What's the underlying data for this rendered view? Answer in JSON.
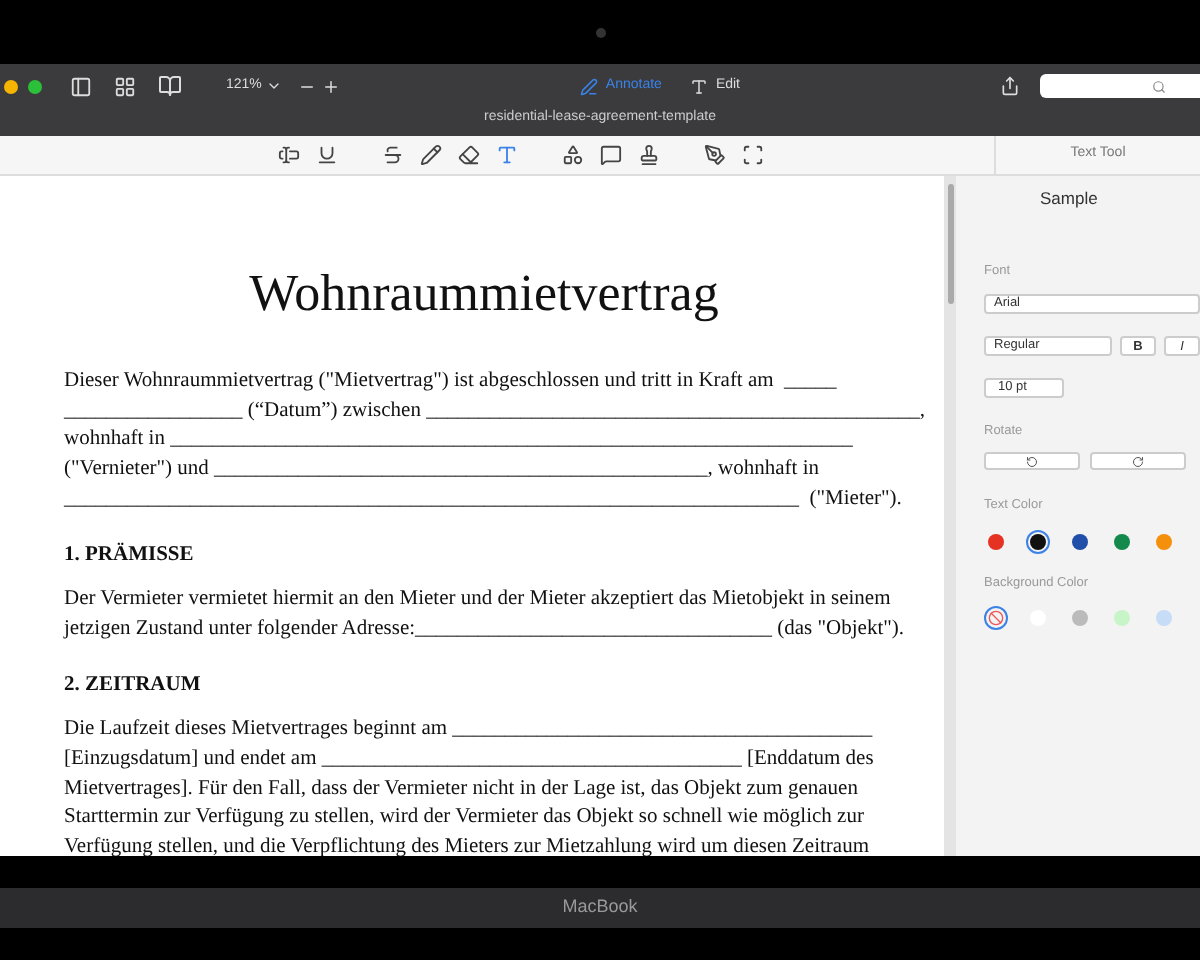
{
  "toolbar": {
    "zoom": "121%",
    "modes": [
      {
        "label": "Annotate",
        "selected": true
      },
      {
        "label": "Edit",
        "selected": false
      }
    ],
    "title": "residential-lease-agreement-template"
  },
  "tools": [
    {
      "kind": "text-box",
      "selected": false
    },
    {
      "kind": "underline",
      "selected": false
    },
    {
      "kind": "strike",
      "selected": false
    },
    {
      "kind": "pencil",
      "selected": false
    },
    {
      "kind": "eraser",
      "selected": false
    },
    {
      "kind": "text",
      "selected": true
    },
    {
      "kind": "shapes",
      "selected": false
    },
    {
      "kind": "comment",
      "selected": false
    },
    {
      "kind": "stamp",
      "selected": false
    },
    {
      "kind": "pen",
      "selected": false
    },
    {
      "kind": "select",
      "selected": false
    }
  ],
  "document": {
    "title": "Wohnraummietvertrag",
    "blocks": [
      {
        "kind": "para",
        "lines": [
          "Dieser Wohnraummietvertrag (\"Mietvertrag\") ist abgeschlossen und tritt in Kraft am  _____",
          "_________________ (“Datum”) zwischen _______________________________________________,",
          "wohnhaft in _________________________________________________________________",
          "(\"Vernieter\") und _______________________________________________, wohnhaft in",
          "______________________________________________________________________  (\"Mieter\")."
        ]
      },
      {
        "kind": "heading",
        "lines": [
          "1. PRÄMISSE"
        ]
      },
      {
        "kind": "para",
        "lines": [
          "Der Vermieter vermietet hiermit an den Mieter und der Mieter akzeptiert das Mietobjekt in seinem",
          "jetzigen Zustand unter folgender Adresse:__________________________________ (das \"Objekt\")."
        ]
      },
      {
        "kind": "heading",
        "lines": [
          "2. ZEITRAUM"
        ]
      },
      {
        "kind": "para",
        "lines": [
          "Die Laufzeit dieses Mietvertrages beginnt am ________________________________________",
          "[Einzugsdatum] und endet am ________________________________________ [Enddatum des",
          "Mietvertrages]. Für den Fall, dass der Vermieter nicht in der Lage ist, das Objekt zum genauen",
          "Starttermin zur Verfügung zu stellen, wird der Vermieter das Objekt so schnell wie möglich zur",
          "Verfügung stellen, und die Verpflichtung des Mieters zur Mietzahlung wird um diesen Zeitraum"
        ]
      }
    ]
  },
  "panel": {
    "title": "Text Tool",
    "sample": "Sample",
    "font_label": "Font",
    "font": "Arial",
    "style": "Regular",
    "bold": "B",
    "italic": "I",
    "size": "10 pt",
    "rotate_label": "Rotate",
    "text_color_label": "Text Color",
    "text_colors": [
      {
        "color": "#e53222",
        "selected": false
      },
      {
        "color": "#111111",
        "selected": true
      },
      {
        "color": "#1f4fa8",
        "selected": false
      },
      {
        "color": "#138a4b",
        "selected": false
      },
      {
        "color": "#f4900c",
        "selected": false
      }
    ],
    "background_color_label": "Background Color",
    "background_colors": [
      {
        "kind": "none",
        "selected": true
      },
      {
        "kind": "swatch",
        "color": "#ffffff",
        "selected": false
      },
      {
        "kind": "swatch",
        "color": "#bbbbbb",
        "selected": false
      },
      {
        "kind": "swatch",
        "color": "#c8f5c8",
        "selected": false
      },
      {
        "kind": "swatch",
        "color": "#c6dcf7",
        "selected": false
      }
    ]
  },
  "device": {
    "label": "MacBook"
  }
}
